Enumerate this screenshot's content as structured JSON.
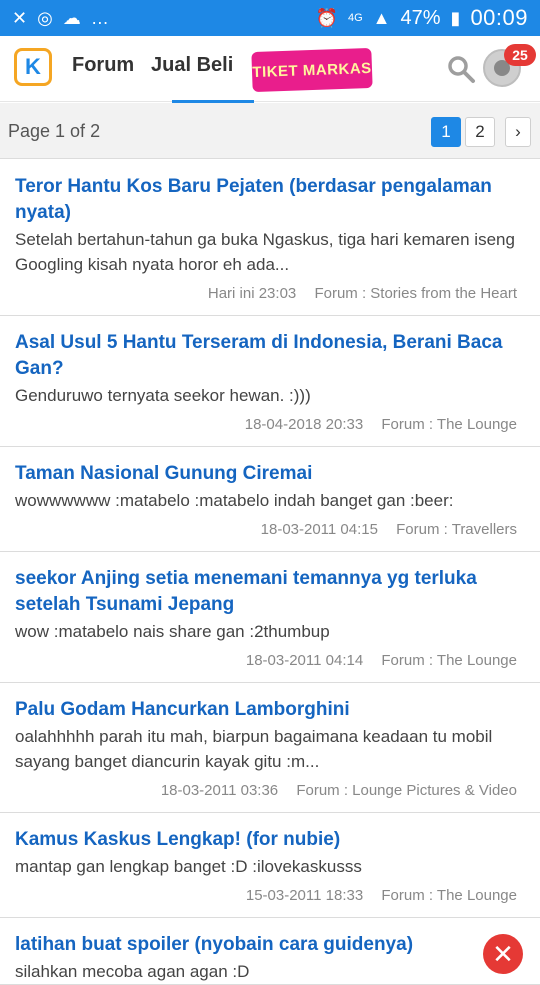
{
  "status_bar": {
    "battery": "47%",
    "time": "00:09",
    "network": "4G",
    "left_icons": [
      "missed-call-icon",
      "instagram-icon",
      "weather-icon",
      "more-dots-icon"
    ],
    "right_icons": [
      "alarm-icon",
      "signal-icon",
      "battery-icon"
    ]
  },
  "app_bar": {
    "logo_glyph": "K",
    "tabs": [
      {
        "label": "Forum"
      },
      {
        "label": "Jual Beli"
      }
    ],
    "promo_label": "TIKET MARKAS",
    "notification_count": "25",
    "icons": [
      "search-icon",
      "avatar"
    ]
  },
  "pagination": {
    "label": "Page 1 of 2",
    "pages": [
      "1",
      "2"
    ],
    "next_label": "›",
    "current": "1"
  },
  "threads": [
    {
      "title": "Teror Hantu Kos Baru Pejaten (berdasar pengalaman nyata)",
      "snippet": "Setelah bertahun-tahun ga buka Ngaskus, tiga hari kemaren iseng Googling kisah nyata horor eh ada...",
      "date": "Hari ini 23:03",
      "forum": "Forum : Stories from the Heart"
    },
    {
      "title": "Asal Usul 5 Hantu Terseram di Indonesia, Berani Baca Gan?",
      "snippet": "Genduruwo ternyata seekor hewan. :)))",
      "date": "18-04-2018 20:33",
      "forum": "Forum : The Lounge"
    },
    {
      "title": "Taman Nasional Gunung Ciremai",
      "snippet": "wowwwwww :matabelo :matabelo indah banget gan :beer:",
      "date": "18-03-2011 04:15",
      "forum": "Forum : Travellers"
    },
    {
      "title": "seekor Anjing setia menemani temannya yg terluka setelah Tsunami Jepang",
      "snippet": "wow :matabelo nais share gan :2thumbup",
      "date": "18-03-2011 04:14",
      "forum": "Forum : The Lounge"
    },
    {
      "title": "Palu Godam Hancurkan Lamborghini",
      "snippet": "oalahhhhh parah itu mah, biarpun bagaimana keadaan tu mobil sayang banget diancurin kayak gitu :m...",
      "date": "18-03-2011 03:36",
      "forum": "Forum : Lounge Pictures & Video"
    },
    {
      "title": "Kamus Kaskus Lengkap! (for nubie)",
      "snippet": "mantap gan lengkap banget :D :ilovekaskusss",
      "date": "15-03-2011 18:33",
      "forum": "Forum : The Lounge"
    },
    {
      "title": "latihan buat spoiler (nyobain cara guidenya)",
      "snippet": "silahkan mecoba agan agan :D",
      "date": "",
      "forum": ""
    }
  ],
  "colors": {
    "status_bar": "#1e88e5",
    "accent": "#1e88e5",
    "title_link": "#1565c0",
    "badge": "#e53935",
    "promo": "#e91e8c"
  }
}
